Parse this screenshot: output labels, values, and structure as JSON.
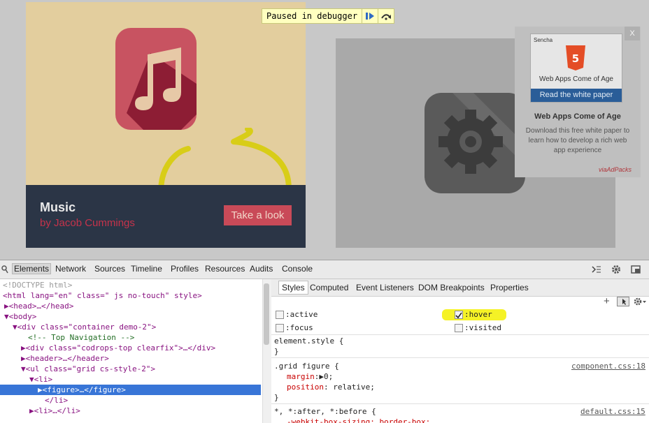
{
  "page": {
    "debugger_banner": "Paused in debugger",
    "card1": {
      "title": "Music",
      "byline": "by Jacob Cummings",
      "cta": "Take a look"
    },
    "ad": {
      "close": "X",
      "sencha": "Sencha",
      "banner_title": "Web Apps Come of Age",
      "read_button": "Read the white paper",
      "title": "Web Apps Come of Age",
      "description": "Download this free white paper to learn how to develop a rich web app experience",
      "via": "viaAdPacks"
    }
  },
  "devtools": {
    "tabs": [
      "Elements",
      "Network",
      "Sources",
      "Timeline",
      "Profiles",
      "Resources",
      "Audits",
      "Console"
    ],
    "dom": [
      "<!DOCTYPE html>",
      "<html lang=\"en\" class=\" js no-touch\" style>",
      "<head>…</head>",
      "<body>",
      "<div class=\"container demo-2\">",
      "<!-- Top Navigation -->",
      "<div class=\"codrops-top clearfix\">…</div>",
      "<header>…</header>",
      "<ul class=\"grid cs-style-2\">",
      "<li>",
      "<figure>…</figure>",
      "</li>",
      "<li>…</li>"
    ],
    "styles_tabs": [
      "Styles",
      "Computed",
      "Event Listeners",
      "DOM Breakpoints",
      "Properties"
    ],
    "pseudo": {
      "active": ":active",
      "hover": ":hover",
      "focus": ":focus",
      "visited": ":visited"
    },
    "rules": {
      "element_open": "element.style {",
      "close": "}",
      "grid_selector": ".grid figure {",
      "grid_src": "component.css:18",
      "margin_prop": "margin",
      "margin_val": "0;",
      "position_prop": "position",
      "position_val": "relative;",
      "default_selector": "*, *:after, *:before {",
      "default_src": "default.css:15",
      "box_sizing": "-webkit-box-sizing: border-box;"
    }
  }
}
